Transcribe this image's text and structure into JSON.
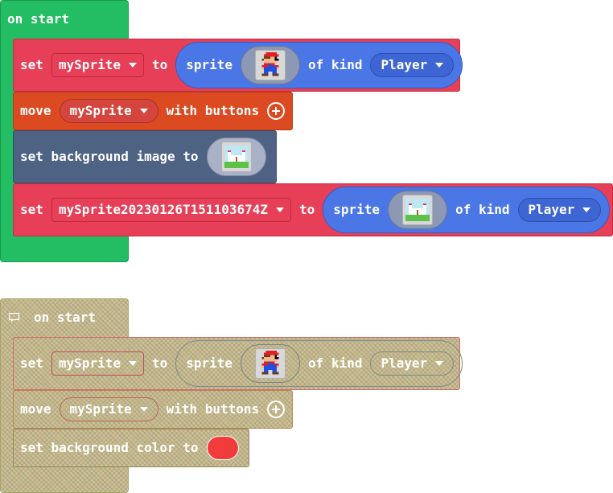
{
  "block1": {
    "hat_label": "on start",
    "set1": {
      "set": "set",
      "var": "mySprite",
      "to": "to",
      "sprite": "sprite",
      "of_kind": "of kind",
      "kind": "Player"
    },
    "move": {
      "move": "move",
      "var": "mySprite",
      "with_buttons": "with buttons"
    },
    "bg": {
      "label": "set background image to"
    },
    "set2": {
      "set": "set",
      "var": "mySprite20230126T151103674Z",
      "to": "to",
      "sprite": "sprite",
      "of_kind": "of kind",
      "kind": "Player"
    }
  },
  "block2": {
    "hat_label": "on start",
    "set1": {
      "set": "set",
      "var": "mySprite",
      "to": "to",
      "sprite": "sprite",
      "of_kind": "of kind",
      "kind": "Player"
    },
    "move": {
      "move": "move",
      "var": "mySprite",
      "with_buttons": "with buttons"
    },
    "bg": {
      "label": "set background color to",
      "color": "#f23b3b"
    }
  },
  "colors": {
    "hat": "#23bd63",
    "variables": "#e63f57",
    "controller": "#dc4a22",
    "scene": "#4e6283",
    "sprite_pill": "#4b77e6"
  }
}
